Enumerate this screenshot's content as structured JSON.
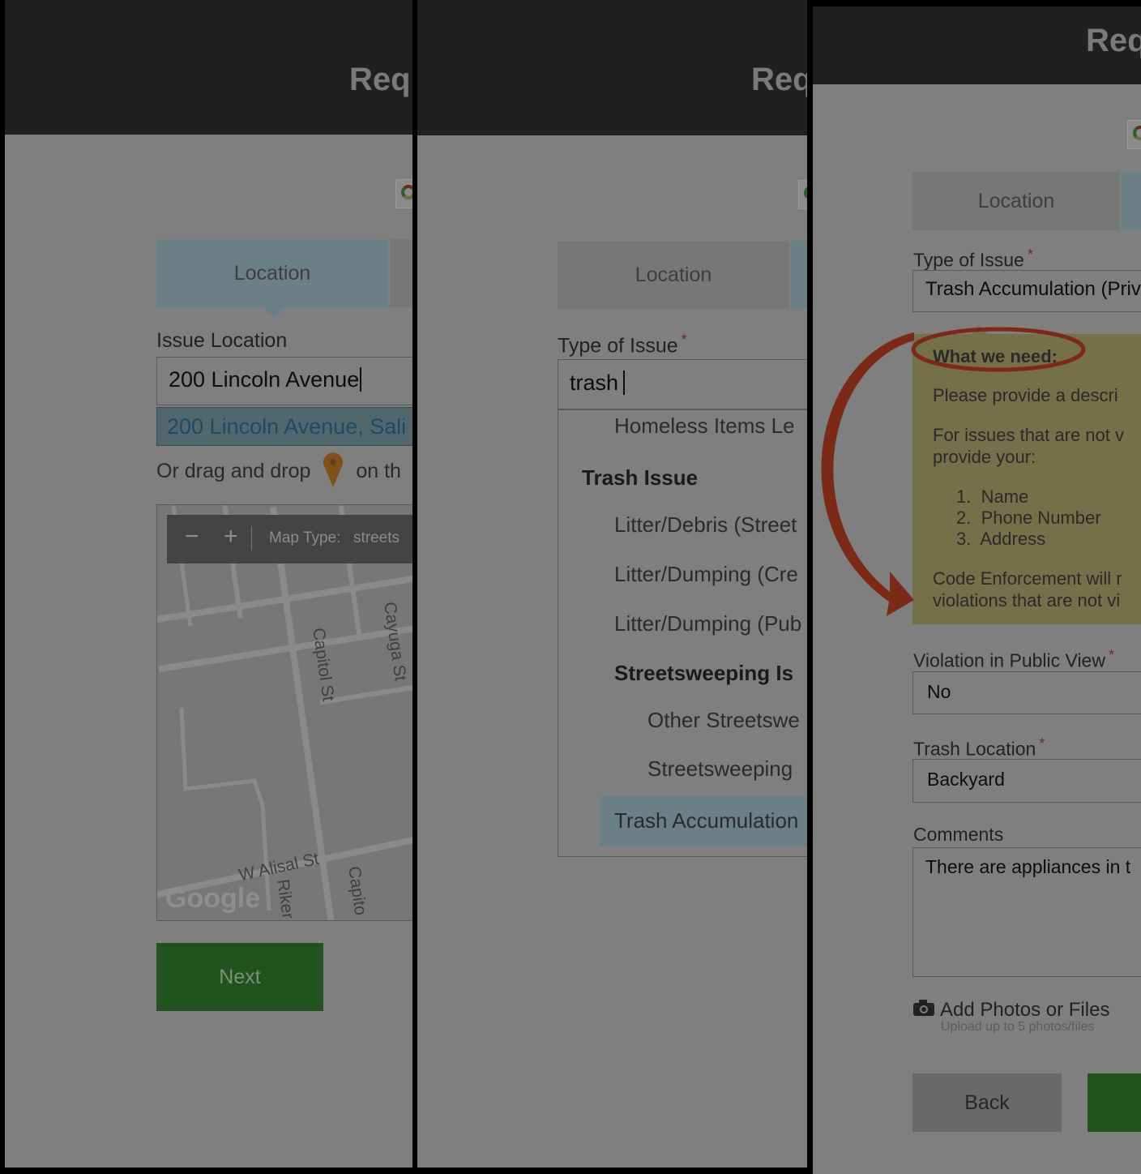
{
  "header": {
    "title": "Req"
  },
  "panel1": {
    "tab_location": "Location",
    "issue_location_label": "Issue Location",
    "address_value": "200 Lincoln Avenue",
    "suggestion": "200 Lincoln Avenue, Sali",
    "drag_text_before": "Or drag and drop",
    "drag_text_after": "on th",
    "map": {
      "zoom_out": "−",
      "zoom_in": "+",
      "map_type_label": "Map Type:",
      "map_type_value": "streets",
      "streets": [
        "Capitol St",
        "Cayuga St",
        "W Alisal St",
        "Riker",
        "Capito",
        "Alisal St"
      ],
      "google_logo": "Google"
    },
    "next_button": "Next"
  },
  "panel2": {
    "tab_location": "Location",
    "type_label": "Type of Issue",
    "required_mark": "*",
    "search_value": "trash",
    "dropdown": [
      {
        "text": "Homeless Items Le",
        "kind": "item",
        "indent": 1
      },
      {
        "text": "Trash Issue",
        "kind": "group",
        "indent": 0
      },
      {
        "text": "Litter/Debris (Street",
        "kind": "item",
        "indent": 1
      },
      {
        "text": "Litter/Dumping (Cre",
        "kind": "item",
        "indent": 1
      },
      {
        "text": "Litter/Dumping (Pub",
        "kind": "item",
        "indent": 1
      },
      {
        "text": "Streetsweeping Is",
        "kind": "group",
        "indent": 1
      },
      {
        "text": "Other Streetswe",
        "kind": "item",
        "indent": 2
      },
      {
        "text": "Streetsweeping",
        "kind": "item",
        "indent": 2
      },
      {
        "text": "Trash Accumulation",
        "kind": "selected",
        "indent": 1
      }
    ]
  },
  "panel3": {
    "tab_location": "Location",
    "type_label": "Type of Issue",
    "type_value": "Trash Accumulation (Priv",
    "info_title": "What we need:",
    "info_line1": "Please provide a descri",
    "info_line2": "For issues that are not v",
    "info_line3": "provide your:",
    "info_list": [
      "Name",
      "Phone Number",
      "Address"
    ],
    "info_line4": "Code Enforcement will r",
    "info_line5": "violations that are not vi",
    "public_view_label": "Violation in Public View",
    "public_view_value": "No",
    "trash_location_label": "Trash Location",
    "trash_location_value": "Backyard",
    "comments_label": "Comments",
    "comments_value": "There are appliances in t",
    "add_photos": "Add Photos or Files",
    "upload_hint": "Upload up to 5 photos/files",
    "back_button": "Back"
  },
  "colors": {
    "annotation": "#7a2a17",
    "overlay": "#7f7f7f"
  }
}
